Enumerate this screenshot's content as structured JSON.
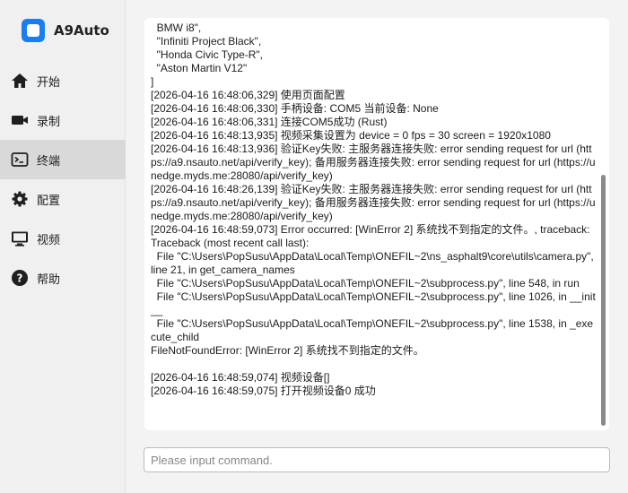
{
  "app": {
    "name": "A9Auto"
  },
  "sidebar": {
    "items": [
      {
        "label": "开始",
        "icon": "home-icon"
      },
      {
        "label": "录制",
        "icon": "video-camera-icon"
      },
      {
        "label": "终端",
        "icon": "terminal-icon",
        "active": true
      },
      {
        "label": "配置",
        "icon": "gear-icon"
      },
      {
        "label": "视频",
        "icon": "monitor-icon"
      },
      {
        "label": "帮助",
        "icon": "help-icon"
      }
    ]
  },
  "terminal": {
    "lines": [
      "  BMW i8\",",
      "  \"Infiniti Project Black\",",
      "  \"Honda Civic Type-R\",",
      "  \"Aston Martin V12\"",
      "]",
      "[2026-04-16 16:48:06,329] 使用页面配置",
      "[2026-04-16 16:48:06,330] 手柄设备: COM5 当前设备: None",
      "[2026-04-16 16:48:06,331] 连接COM5成功 (Rust)",
      "[2026-04-16 16:48:13,935] 视频采集设置为 device = 0 fps = 30 screen = 1920x1080",
      "[2026-04-16 16:48:13,936] 验证Key失败: 主服务器连接失败: error sending request for url (https://a9.nsauto.net/api/verify_key); 备用服务器连接失败: error sending request for url (https://unedge.myds.me:28080/api/verify_key)",
      "[2026-04-16 16:48:26,139] 验证Key失败: 主服务器连接失败: error sending request for url (https://a9.nsauto.net/api/verify_key); 备用服务器连接失败: error sending request for url (https://unedge.myds.me:28080/api/verify_key)",
      "[2026-04-16 16:48:59,073] Error occurred: [WinError 2] 系统找不到指定的文件。, traceback: Traceback (most recent call last):",
      "  File \"C:\\Users\\PopSusu\\AppData\\Local\\Temp\\ONEFIL~2\\ns_asphalt9\\core\\utils\\camera.py\", line 21, in get_camera_names",
      "  File \"C:\\Users\\PopSusu\\AppData\\Local\\Temp\\ONEFIL~2\\subprocess.py\", line 548, in run",
      "  File \"C:\\Users\\PopSusu\\AppData\\Local\\Temp\\ONEFIL~2\\subprocess.py\", line 1026, in __init__",
      "  File \"C:\\Users\\PopSusu\\AppData\\Local\\Temp\\ONEFIL~2\\subprocess.py\", line 1538, in _execute_child",
      "FileNotFoundError: [WinError 2] 系统找不到指定的文件。",
      "",
      "[2026-04-16 16:48:59,074] 视频设备[]",
      "[2026-04-16 16:48:59,075] 打开视频设备0 成功"
    ]
  },
  "command": {
    "placeholder": "Please input command.",
    "value": ""
  }
}
